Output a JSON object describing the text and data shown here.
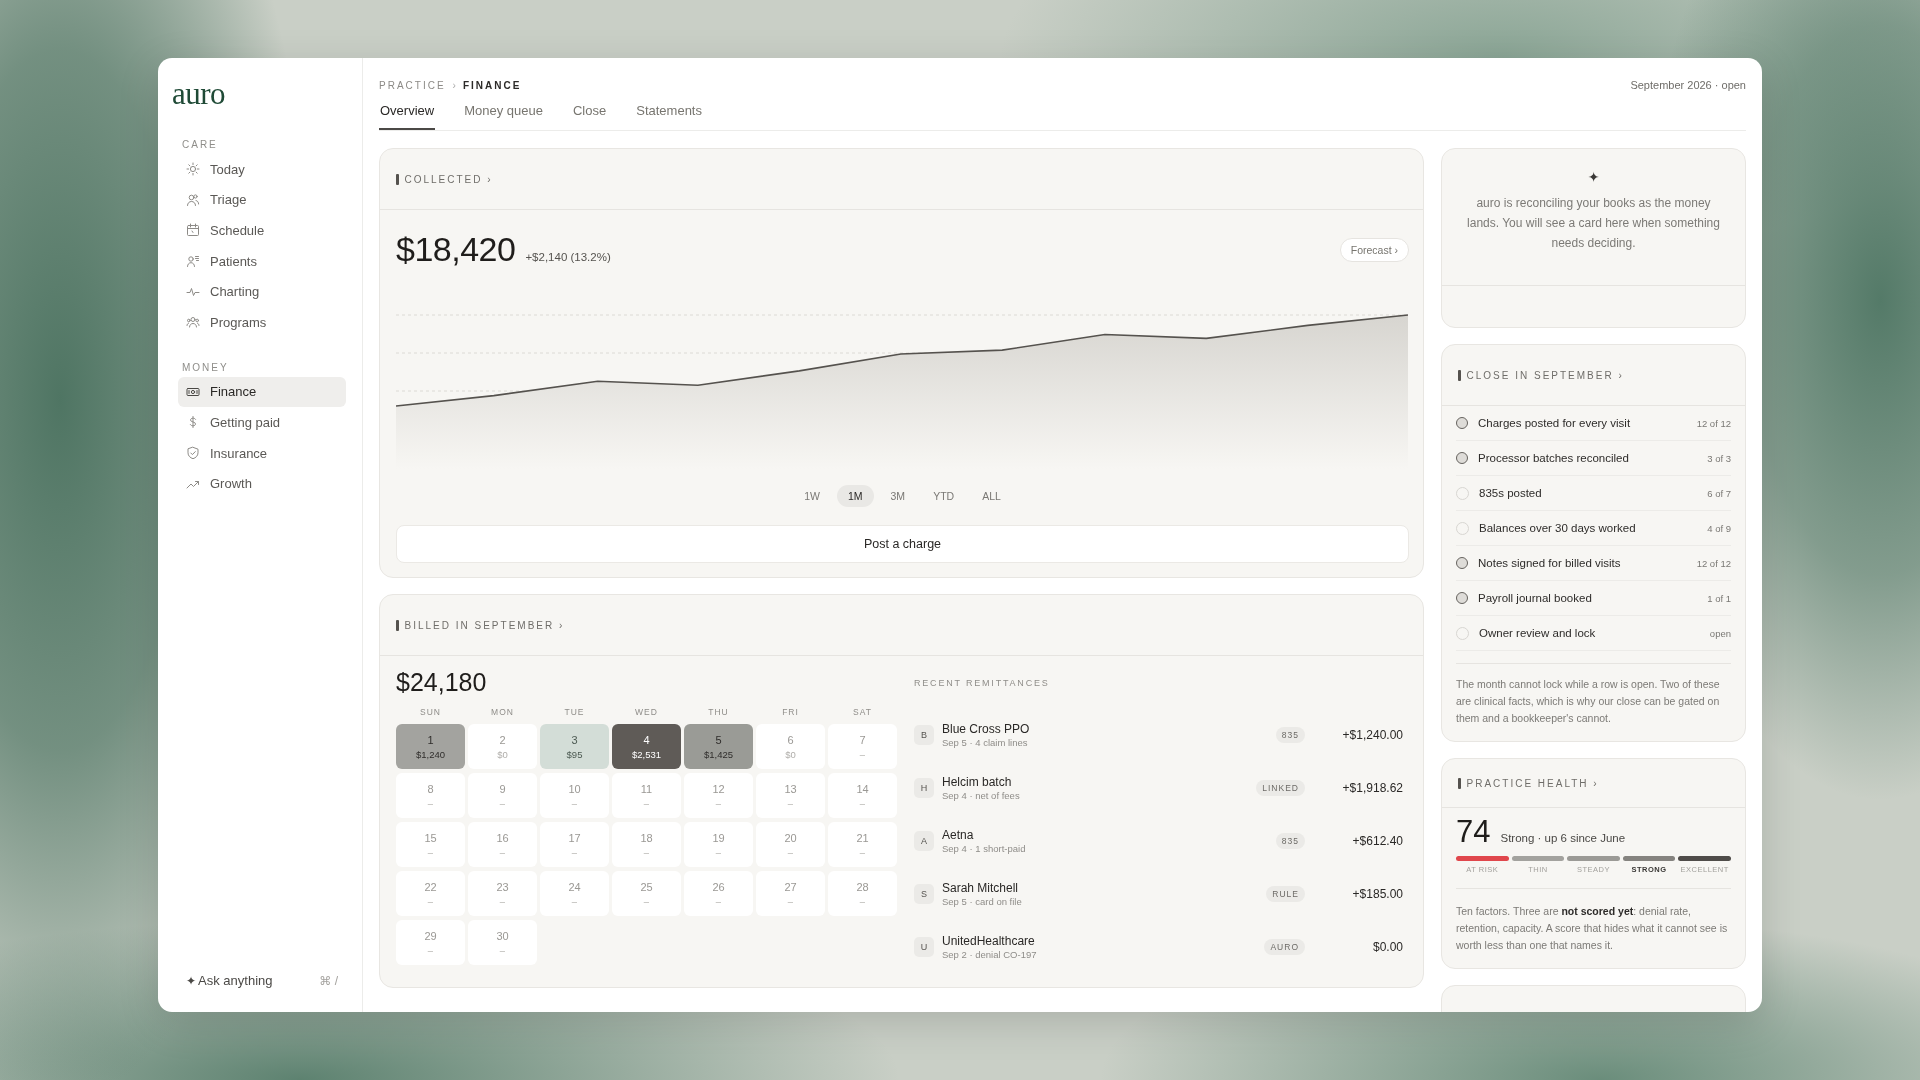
{
  "logo": "auro",
  "sidebar": {
    "sections": [
      {
        "title": "CARE",
        "items": [
          {
            "label": "Today",
            "selected": false
          },
          {
            "label": "Triage",
            "selected": false
          },
          {
            "label": "Schedule",
            "selected": false
          },
          {
            "label": "Patients",
            "selected": false
          },
          {
            "label": "Charting",
            "selected": false
          },
          {
            "label": "Programs",
            "selected": false
          }
        ]
      },
      {
        "title": "MONEY",
        "items": [
          {
            "label": "Finance",
            "selected": true
          },
          {
            "label": "Getting paid",
            "selected": false
          },
          {
            "label": "Insurance",
            "selected": false
          },
          {
            "label": "Growth",
            "selected": false
          }
        ]
      }
    ],
    "ask": {
      "icon": "✦",
      "label": "Ask anything",
      "shortcut": "⌘ /"
    }
  },
  "breadcrumb": [
    "PRACTICE",
    "›",
    "FINANCE"
  ],
  "period": "September 2026 · open",
  "tabs": [
    {
      "label": "Overview",
      "selected": true
    },
    {
      "label": "Money queue",
      "selected": false
    },
    {
      "label": "Close",
      "selected": false
    },
    {
      "label": "Statements",
      "selected": false
    }
  ],
  "collected": {
    "title": "COLLECTED",
    "chevron": "›",
    "amount": "$18,420",
    "change": "+$2,140 (13.2%)",
    "forecast": "Forecast ›",
    "ranges": [
      {
        "label": "1W",
        "selected": false
      },
      {
        "label": "1M",
        "selected": true
      },
      {
        "label": "3M",
        "selected": false
      },
      {
        "label": "YTD",
        "selected": false
      },
      {
        "label": "ALL",
        "selected": false
      }
    ],
    "action": "Post a charge"
  },
  "billed": {
    "title": "BILLED IN SEPTEMBER",
    "chevron": "›",
    "amount": "$24,180",
    "weekdays": [
      "SUN",
      "MON",
      "TUE",
      "WED",
      "THU",
      "FRI",
      "SAT"
    ],
    "days": [
      {
        "day": "1",
        "value": "$1,240",
        "color": "#a3a39f"
      },
      {
        "day": "2",
        "value": "$0",
        "color": "#ffffff"
      },
      {
        "day": "3",
        "value": "$95",
        "color": "#d3ddd7"
      },
      {
        "day": "4",
        "value": "$2,531",
        "color": "#5f5b57"
      },
      {
        "day": "5",
        "value": "$1,425",
        "color": "#9a9b96"
      },
      {
        "day": "6",
        "value": "$0",
        "color": "#ffffff"
      },
      {
        "day": "7",
        "value": "–",
        "color": "#ffffff"
      },
      {
        "day": "8",
        "value": "–",
        "color": "#ffffff"
      },
      {
        "day": "9",
        "value": "–",
        "color": "#ffffff"
      },
      {
        "day": "10",
        "value": "–",
        "color": "#ffffff"
      },
      {
        "day": "11",
        "value": "–",
        "color": "#ffffff"
      },
      {
        "day": "12",
        "value": "–",
        "color": "#ffffff"
      },
      {
        "day": "13",
        "value": "–",
        "color": "#ffffff"
      },
      {
        "day": "14",
        "value": "–",
        "color": "#ffffff"
      },
      {
        "day": "15",
        "value": "–",
        "color": "#ffffff"
      },
      {
        "day": "16",
        "value": "–",
        "color": "#ffffff"
      },
      {
        "day": "17",
        "value": "–",
        "color": "#ffffff"
      },
      {
        "day": "18",
        "value": "–",
        "color": "#ffffff"
      },
      {
        "day": "19",
        "value": "–",
        "color": "#ffffff"
      },
      {
        "day": "20",
        "value": "–",
        "color": "#ffffff"
      },
      {
        "day": "21",
        "value": "–",
        "color": "#ffffff"
      },
      {
        "day": "22",
        "value": "–",
        "color": "#ffffff"
      },
      {
        "day": "23",
        "value": "–",
        "color": "#ffffff"
      },
      {
        "day": "24",
        "value": "–",
        "color": "#ffffff"
      },
      {
        "day": "25",
        "value": "–",
        "color": "#ffffff"
      },
      {
        "day": "26",
        "value": "–",
        "color": "#ffffff"
      },
      {
        "day": "27",
        "value": "–",
        "color": "#ffffff"
      },
      {
        "day": "28",
        "value": "–",
        "color": "#ffffff"
      },
      {
        "day": "29",
        "value": "–",
        "color": "#ffffff"
      },
      {
        "day": "30",
        "value": "–",
        "color": "#ffffff"
      }
    ],
    "remittances_title": "RECENT REMITTANCES",
    "remittances": [
      {
        "initial": "B",
        "name": "Blue Cross PPO",
        "detail": "Sep 5 · 4 claim lines",
        "tag": "835",
        "amount": "+$1,240.00"
      },
      {
        "initial": "H",
        "name": "Helcim batch",
        "detail": "Sep 4 · net of fees",
        "tag": "LINKED",
        "amount": "+$1,918.62"
      },
      {
        "initial": "A",
        "name": "Aetna",
        "detail": "Sep 4 · 1 short-paid",
        "tag": "835",
        "amount": "+$612.40"
      },
      {
        "initial": "S",
        "name": "Sarah Mitchell",
        "detail": "Sep 5 · card on file",
        "tag": "RULE",
        "amount": "+$185.00"
      },
      {
        "initial": "U",
        "name": "UnitedHealthcare",
        "detail": "Sep 2 · denial CO-197",
        "tag": "AURO",
        "amount": "$0.00"
      }
    ]
  },
  "assistant": {
    "icon": "✦",
    "message": "auro is reconciling your books as the money lands. You will see a card here when something needs deciding."
  },
  "close": {
    "title": "CLOSE IN SEPTEMBER",
    "chevron": "›",
    "items": [
      {
        "label": "Charges posted for every visit",
        "count": "12 of 12",
        "done": true
      },
      {
        "label": "Processor batches reconciled",
        "count": "3 of 3",
        "done": true
      },
      {
        "label": "835s posted",
        "count": "6 of 7",
        "done": false
      },
      {
        "label": "Balances over 30 days worked",
        "count": "4 of 9",
        "done": false
      },
      {
        "label": "Notes signed for billed visits",
        "count": "12 of 12",
        "done": true
      },
      {
        "label": "Payroll journal booked",
        "count": "1 of 1",
        "done": true
      },
      {
        "label": "Owner review and lock",
        "count": "open",
        "done": false
      }
    ],
    "note": "The month cannot lock while a row is open. Two of these are clinical facts, which is why our close can be gated on them and a bookkeeper's cannot."
  },
  "health": {
    "title": "PRACTICE HEALTH",
    "chevron": "›",
    "score": "74",
    "summary": "Strong · up 6 since June",
    "bands": [
      {
        "label": "AT RISK",
        "color": "#e0474c",
        "selected": false
      },
      {
        "label": "THIN",
        "color": "#a3a29e",
        "selected": false
      },
      {
        "label": "STEADY",
        "color": "#9b9a96",
        "selected": false
      },
      {
        "label": "STRONG",
        "color": "#85837f",
        "selected": true
      },
      {
        "label": "EXCELLENT",
        "color": "#4f4c49",
        "selected": false
      }
    ],
    "note": "Ten factors. Three are **not scored yet**: denial rate, retention, capacity. A score that hides what it cannot see is worth less than one that names it."
  }
}
